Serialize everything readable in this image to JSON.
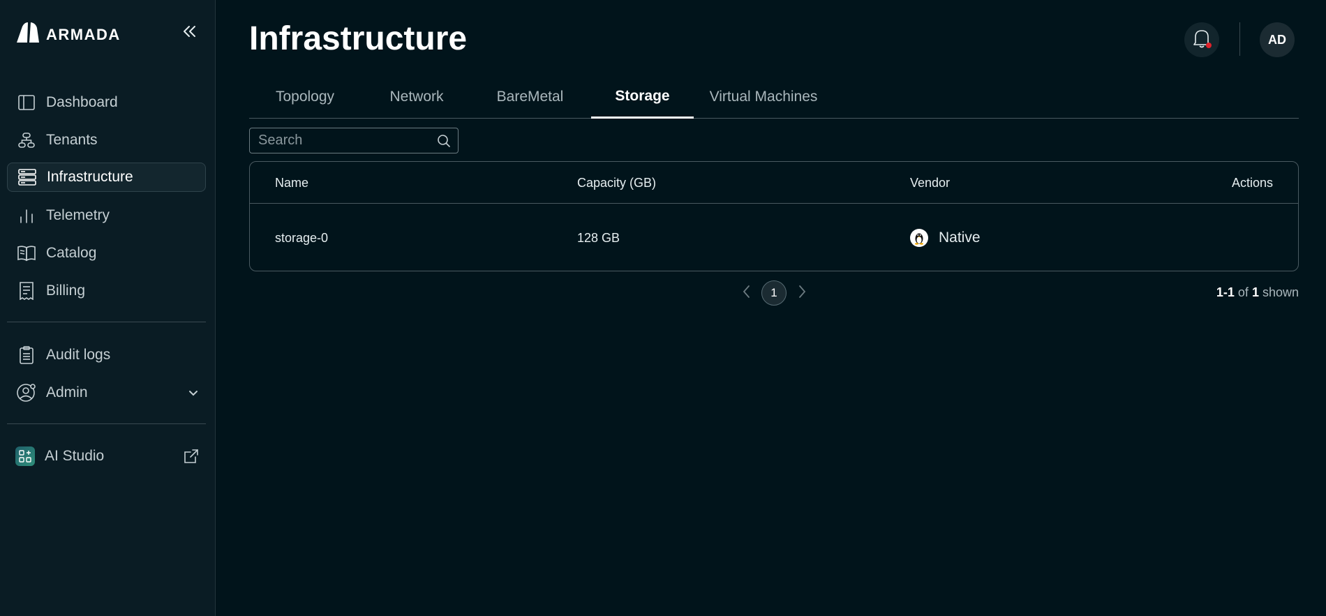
{
  "brand": {
    "name": "ARMADA"
  },
  "sidebar": {
    "items": [
      {
        "label": "Dashboard",
        "icon": "layout-sidebar-icon"
      },
      {
        "label": "Tenants",
        "icon": "hierarchy-icon"
      },
      {
        "label": "Infrastructure",
        "icon": "server-rack-icon",
        "active": true
      },
      {
        "label": "Telemetry",
        "icon": "bar-chart-icon"
      },
      {
        "label": "Catalog",
        "icon": "book-icon"
      },
      {
        "label": "Billing",
        "icon": "receipt-icon"
      }
    ],
    "secondary": [
      {
        "label": "Audit logs",
        "icon": "clipboard-icon"
      },
      {
        "label": "Admin",
        "icon": "user-gear-icon"
      }
    ],
    "external": {
      "label": "AI Studio",
      "icon": "apps-icon"
    }
  },
  "header": {
    "title": "Infrastructure",
    "avatar_initials": "AD"
  },
  "tabs": [
    "Topology",
    "Network",
    "BareMetal",
    "Storage",
    "Virtual Machines"
  ],
  "active_tab": "Storage",
  "search": {
    "placeholder": "Search"
  },
  "table": {
    "columns": [
      "Name",
      "Capacity (GB)",
      "Vendor",
      "Actions"
    ],
    "rows": [
      {
        "name": "storage-0",
        "capacity": "128 GB",
        "vendor": "Native"
      }
    ]
  },
  "pagination": {
    "current_page": "1",
    "range_start": "1",
    "range_sep": "-",
    "range_end": "1",
    "of_word": "of",
    "total": "1",
    "shown_word": "shown"
  },
  "colors": {
    "background": "#01141b",
    "sidebar": "#0a1c24",
    "notification_dot": "#e0222b"
  }
}
